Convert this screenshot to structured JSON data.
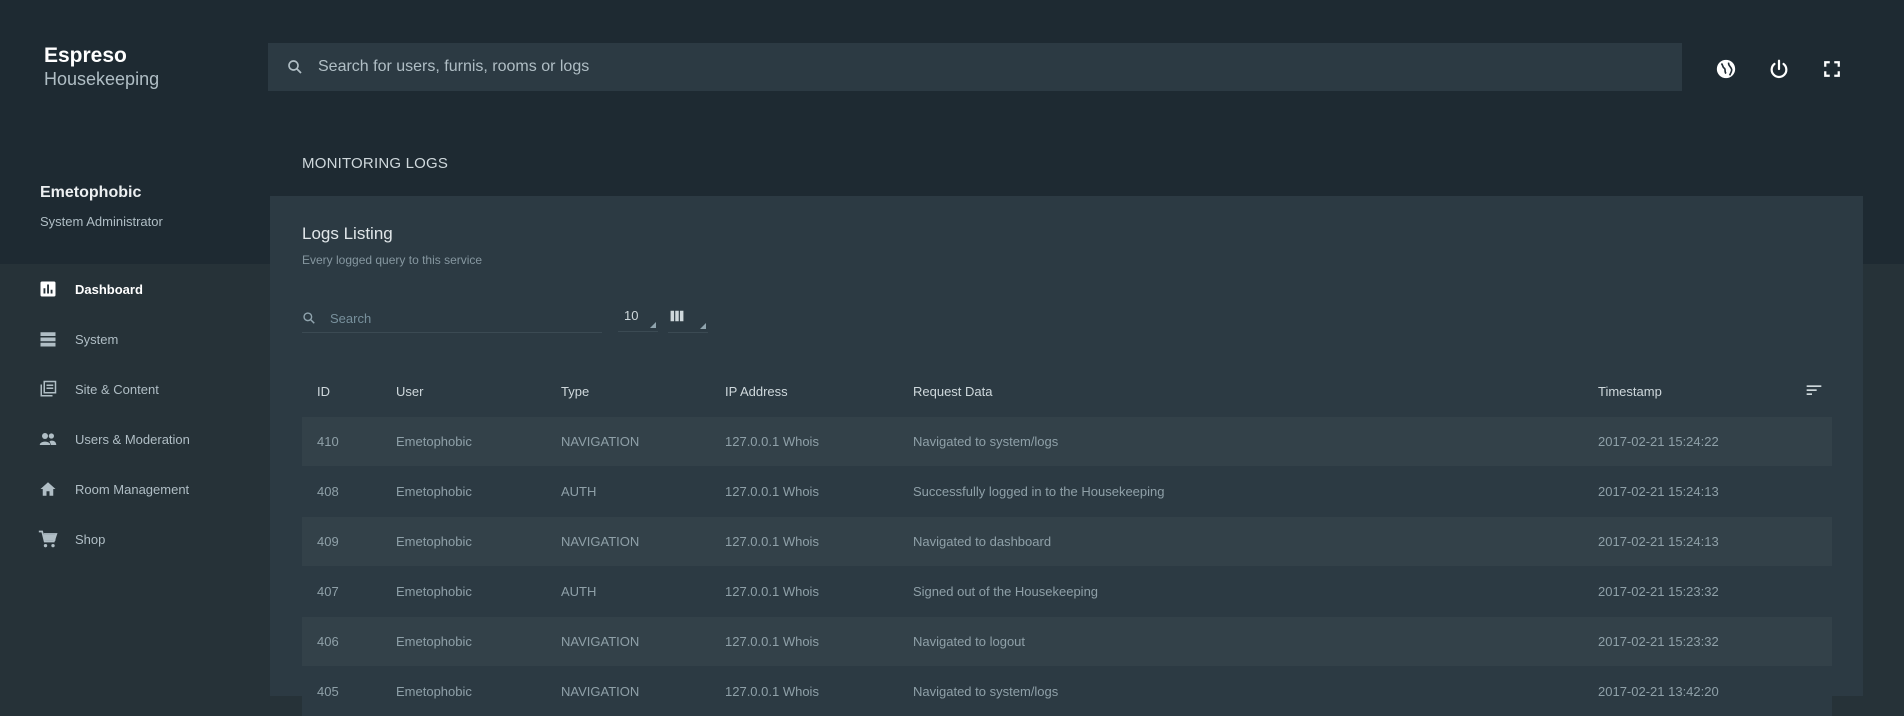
{
  "brand": {
    "name": "Espreso",
    "subtitle": "Housekeeping"
  },
  "search": {
    "placeholder": "Search for users, furnis, rooms or logs"
  },
  "header_icons": [
    "globe-icon",
    "power-icon",
    "fullscreen-icon"
  ],
  "user": {
    "name": "Emetophobic",
    "role": "System Administrator"
  },
  "sidebar": {
    "items": [
      {
        "label": "Dashboard",
        "icon": "bar-chart-icon",
        "active": true
      },
      {
        "label": "System",
        "icon": "server-icon"
      },
      {
        "label": "Site & Content",
        "icon": "library-icon"
      },
      {
        "label": "Users & Moderation",
        "icon": "people-icon"
      },
      {
        "label": "Room Management",
        "icon": "home-icon"
      },
      {
        "label": "Shop",
        "icon": "cart-icon"
      }
    ]
  },
  "page": {
    "title": "MONITORING LOGS"
  },
  "card": {
    "title": "Logs Listing",
    "subtitle": "Every logged query to this service",
    "search_placeholder": "Search",
    "page_size": "10"
  },
  "table": {
    "columns": [
      "ID",
      "User",
      "Type",
      "IP Address",
      "Request Data",
      "Timestamp"
    ],
    "rows": [
      [
        "410",
        "Emetophobic",
        "NAVIGATION",
        "127.0.0.1 Whois",
        "Navigated to system/logs",
        "2017-02-21 15:24:22"
      ],
      [
        "408",
        "Emetophobic",
        "AUTH",
        "127.0.0.1 Whois",
        "Successfully logged in to the Housekeeping",
        "2017-02-21 15:24:13"
      ],
      [
        "409",
        "Emetophobic",
        "NAVIGATION",
        "127.0.0.1 Whois",
        "Navigated to dashboard",
        "2017-02-21 15:24:13"
      ],
      [
        "407",
        "Emetophobic",
        "AUTH",
        "127.0.0.1 Whois",
        "Signed out of the Housekeeping",
        "2017-02-21 15:23:32"
      ],
      [
        "406",
        "Emetophobic",
        "NAVIGATION",
        "127.0.0.1 Whois",
        "Navigated to logout",
        "2017-02-21 15:23:32"
      ],
      [
        "405",
        "Emetophobic",
        "NAVIGATION",
        "127.0.0.1 Whois",
        "Navigated to system/logs",
        "2017-02-21 13:42:20"
      ]
    ]
  },
  "colors": {
    "background": "#263238",
    "header": "#1e2a32",
    "card": "#2c3a43",
    "row_alt": "#334149"
  }
}
